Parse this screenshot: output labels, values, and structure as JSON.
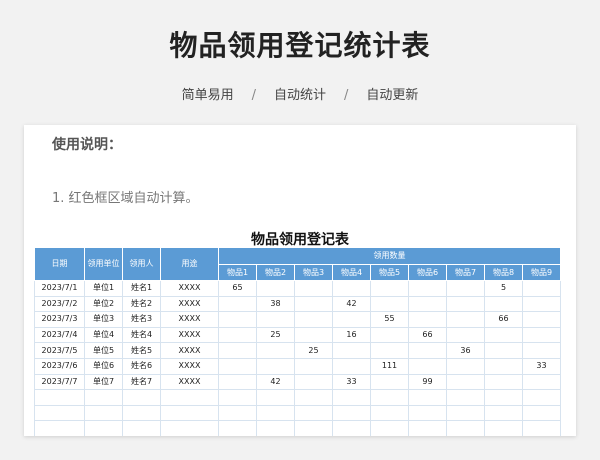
{
  "header": {
    "title": "物品领用登记统计表",
    "subtitle": [
      "简单易用",
      "自动统计",
      "自动更新"
    ],
    "separator": "/"
  },
  "instructions": {
    "heading": "使用说明：",
    "items": [
      "1. 红色框区域自动计算。"
    ]
  },
  "table": {
    "title": "物品领用登记表",
    "headers": {
      "date": "日期",
      "unit": "领用单位",
      "person": "领用人",
      "purpose": "用途",
      "quantity_group": "领用数量",
      "items": [
        "物品1",
        "物品2",
        "物品3",
        "物品4",
        "物品5",
        "物品6",
        "物品7",
        "物品8",
        "物品9"
      ]
    },
    "rows": [
      {
        "date": "2023/7/1",
        "unit": "单位1",
        "person": "姓名1",
        "purpose": "XXXX",
        "qty": [
          "65",
          "",
          "",
          "",
          "",
          "",
          "",
          "5",
          ""
        ]
      },
      {
        "date": "2023/7/2",
        "unit": "单位2",
        "person": "姓名2",
        "purpose": "XXXX",
        "qty": [
          "",
          "38",
          "",
          "42",
          "",
          "",
          "",
          "",
          ""
        ]
      },
      {
        "date": "2023/7/3",
        "unit": "单位3",
        "person": "姓名3",
        "purpose": "XXXX",
        "qty": [
          "",
          "",
          "",
          "",
          "55",
          "",
          "",
          "66",
          ""
        ]
      },
      {
        "date": "2023/7/4",
        "unit": "单位4",
        "person": "姓名4",
        "purpose": "XXXX",
        "qty": [
          "",
          "25",
          "",
          "16",
          "",
          "66",
          "",
          "",
          ""
        ]
      },
      {
        "date": "2023/7/5",
        "unit": "单位5",
        "person": "姓名5",
        "purpose": "XXXX",
        "qty": [
          "",
          "",
          "25",
          "",
          "",
          "",
          "36",
          "",
          ""
        ]
      },
      {
        "date": "2023/7/6",
        "unit": "单位6",
        "person": "姓名6",
        "purpose": "XXXX",
        "qty": [
          "",
          "",
          "",
          "",
          "111",
          "",
          "",
          "",
          "33"
        ]
      },
      {
        "date": "2023/7/7",
        "unit": "单位7",
        "person": "姓名7",
        "purpose": "XXXX",
        "qty": [
          "",
          "42",
          "",
          "33",
          "",
          "99",
          "",
          "",
          ""
        ]
      }
    ],
    "blank_rows": 3
  }
}
